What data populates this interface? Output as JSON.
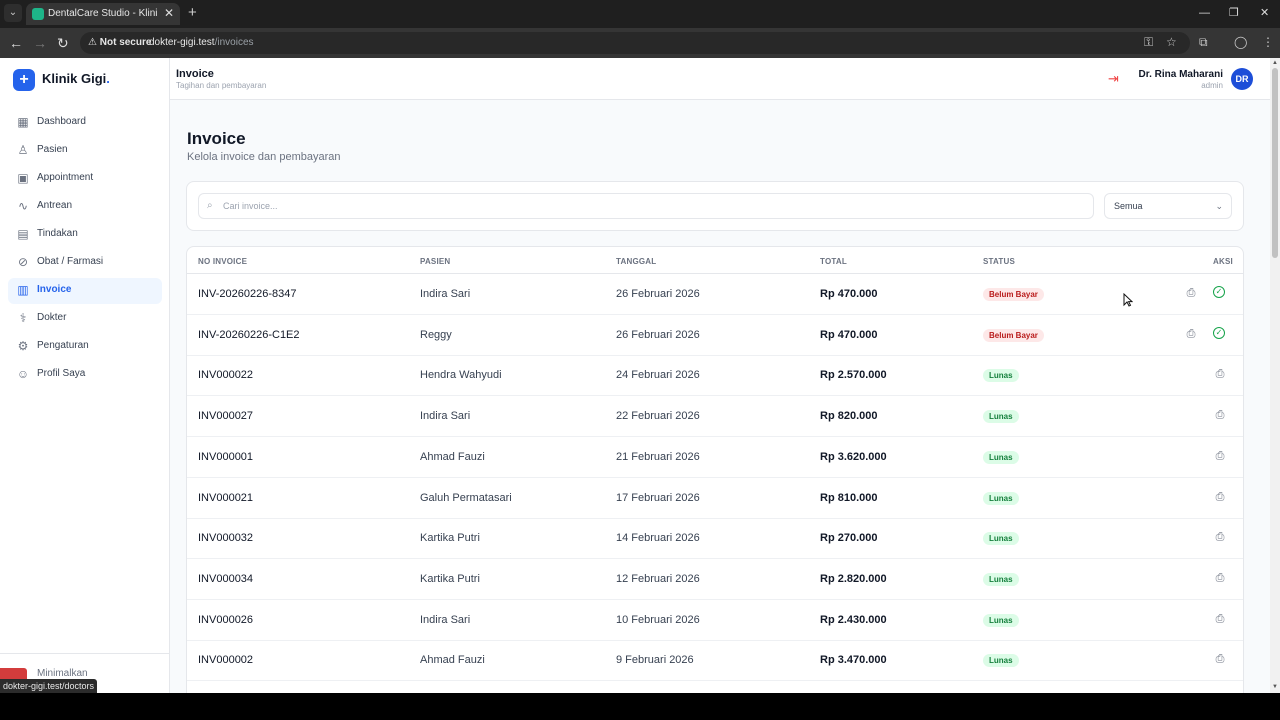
{
  "browser": {
    "tab_title": "DentalCare Studio - Klinik Gigi",
    "tab_close": "✕",
    "new_tab": "+",
    "not_secure": "Not secure",
    "url_host": "dokter-gigi.test",
    "url_path": "/invoices",
    "status_url": "dokter-gigi.test/doctors",
    "icons": [
      "tab-search-icon",
      "key-icon",
      "star-icon",
      "extensions-icon",
      "profile-icon",
      "menu-icon",
      "minimize-icon",
      "restore-icon",
      "close-icon"
    ]
  },
  "sidebar": {
    "logo_glyph": "+",
    "brand": "Klinik Gigi",
    "brand_dot": ".",
    "items": [
      {
        "label": "Dashboard",
        "icon": "grid-icon",
        "glyph": "▦"
      },
      {
        "label": "Pasien",
        "icon": "users-icon",
        "glyph": "♙"
      },
      {
        "label": "Appointment",
        "icon": "calendar-icon",
        "glyph": "▣"
      },
      {
        "label": "Antrean",
        "icon": "activity-icon",
        "glyph": "∿"
      },
      {
        "label": "Tindakan",
        "icon": "clipboard-icon",
        "glyph": "▤"
      },
      {
        "label": "Obat / Farmasi",
        "icon": "pill-icon",
        "glyph": "⊘"
      },
      {
        "label": "Invoice",
        "icon": "receipt-icon",
        "glyph": "▥"
      },
      {
        "label": "Dokter",
        "icon": "stethoscope-icon",
        "glyph": "⚕"
      },
      {
        "label": "Pengaturan",
        "icon": "gear-icon",
        "glyph": "⚙"
      },
      {
        "label": "Profil Saya",
        "icon": "user-circle-icon",
        "glyph": "☺"
      }
    ],
    "active_index": 6,
    "minimize_label": "Minimalkan"
  },
  "header": {
    "title": "Invoice",
    "subtitle": "Tagihan dan pembayaran",
    "user_name": "Dr. Rina Maharani",
    "user_role": "admin",
    "avatar_initials": "DR"
  },
  "main": {
    "title": "Invoice",
    "subtitle": "Kelola invoice dan pembayaran",
    "search_placeholder": "Cari invoice...",
    "filter_value": "Semua"
  },
  "table": {
    "columns": [
      "NO INVOICE",
      "PASIEN",
      "TANGGAL",
      "TOTAL",
      "STATUS",
      "AKSI"
    ],
    "rows": [
      {
        "no": "INV-20260226-8347",
        "patient": "Indira Sari",
        "date": "26 Februari 2026",
        "total": "Rp 470.000",
        "status": "Belum Bayar",
        "paid": false
      },
      {
        "no": "INV-20260226-C1E2",
        "patient": "Reggy",
        "date": "26 Februari 2026",
        "total": "Rp 470.000",
        "status": "Belum Bayar",
        "paid": false
      },
      {
        "no": "INV000022",
        "patient": "Hendra Wahyudi",
        "date": "24 Februari 2026",
        "total": "Rp 2.570.000",
        "status": "Lunas",
        "paid": true
      },
      {
        "no": "INV000027",
        "patient": "Indira Sari",
        "date": "22 Februari 2026",
        "total": "Rp 820.000",
        "status": "Lunas",
        "paid": true
      },
      {
        "no": "INV000001",
        "patient": "Ahmad Fauzi",
        "date": "21 Februari 2026",
        "total": "Rp 3.620.000",
        "status": "Lunas",
        "paid": true
      },
      {
        "no": "INV000021",
        "patient": "Galuh Permatasari",
        "date": "17 Februari 2026",
        "total": "Rp 810.000",
        "status": "Lunas",
        "paid": true
      },
      {
        "no": "INV000032",
        "patient": "Kartika Putri",
        "date": "14 Februari 2026",
        "total": "Rp 270.000",
        "status": "Lunas",
        "paid": true
      },
      {
        "no": "INV000034",
        "patient": "Kartika Putri",
        "date": "12 Februari 2026",
        "total": "Rp 2.820.000",
        "status": "Lunas",
        "paid": true
      },
      {
        "no": "INV000026",
        "patient": "Indira Sari",
        "date": "10 Februari 2026",
        "total": "Rp 2.430.000",
        "status": "Lunas",
        "paid": true
      },
      {
        "no": "INV000002",
        "patient": "Ahmad Fauzi",
        "date": "9 Februari 2026",
        "total": "Rp 3.470.000",
        "status": "Lunas",
        "paid": true
      }
    ]
  },
  "colors": {
    "accent": "#2563eb",
    "unpaid_bg": "#fde8e8",
    "unpaid_text": "#b91c1c",
    "paid_bg": "#dcfce7",
    "paid_text": "#15803d",
    "logout": "#ef4444"
  }
}
